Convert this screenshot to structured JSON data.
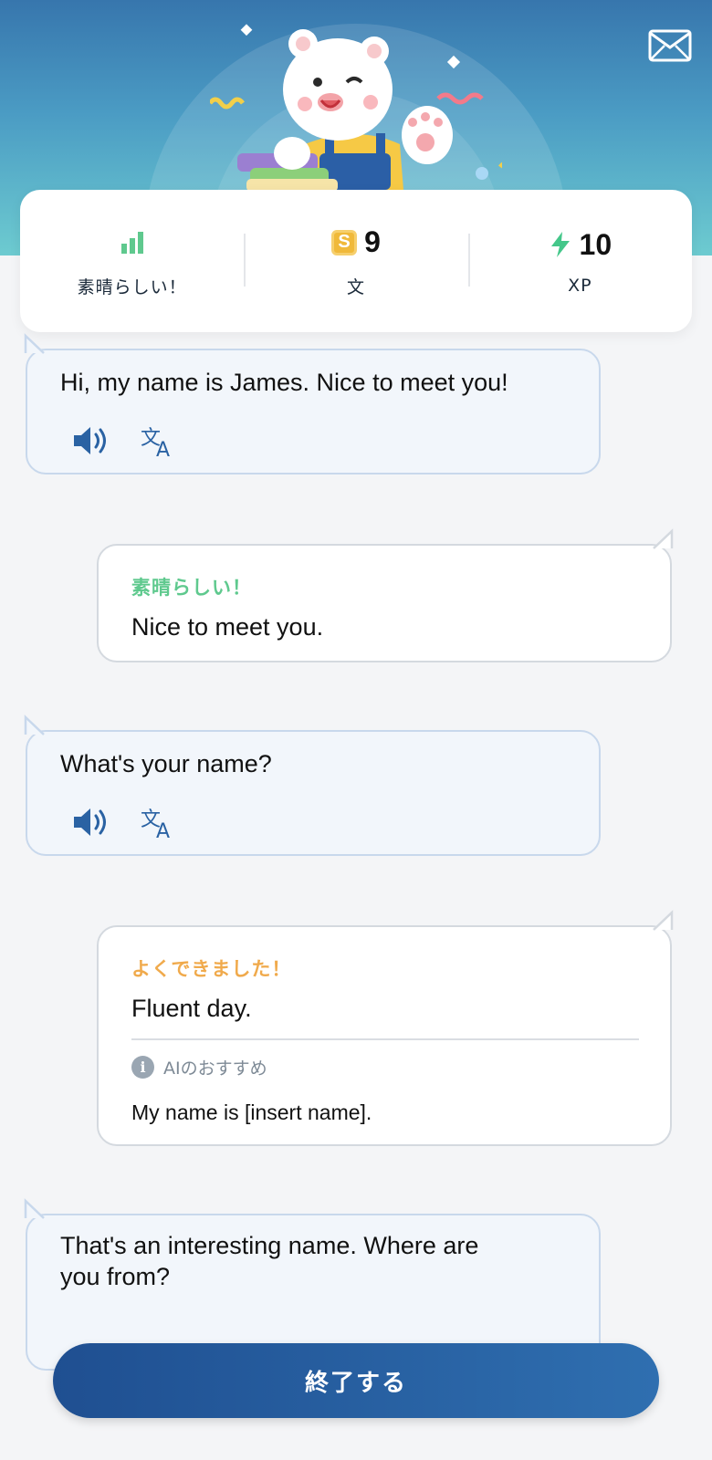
{
  "stats": {
    "level_label": "素晴らしい！",
    "sentences_value": "9",
    "sentences_badge": "S",
    "sentences_label": "文",
    "xp_value": "10",
    "xp_label": "XP"
  },
  "messages": [
    {
      "role": "bot",
      "text": "Hi, my name is James. Nice to meet you!"
    },
    {
      "role": "user",
      "grade": "素晴らしい！",
      "grade_color": "#5fc98e",
      "text": "Nice to meet you."
    },
    {
      "role": "bot",
      "text": "What's your name?"
    },
    {
      "role": "user",
      "grade": "よくできました！",
      "grade_color": "#f0aa4c",
      "text": "Fluent day.",
      "suggestion_label": "AIのおすすめ",
      "suggestion_text": "My name is [insert name]."
    },
    {
      "role": "bot",
      "text_line1": "That's an interesting name. Where are",
      "text_line2": "you from?"
    }
  ],
  "info_glyph": "i",
  "finish_button": "終了する",
  "icons": {
    "mail": "mail-icon",
    "level": "signal-bars-icon",
    "xp": "lightning-icon",
    "speaker": "speaker-icon",
    "translate": "translate-icon",
    "info": "info-icon"
  },
  "colors": {
    "accent": "#2a62a3",
    "great": "#5fc98e",
    "good": "#f0aa4c",
    "xp": "#44c78a"
  }
}
